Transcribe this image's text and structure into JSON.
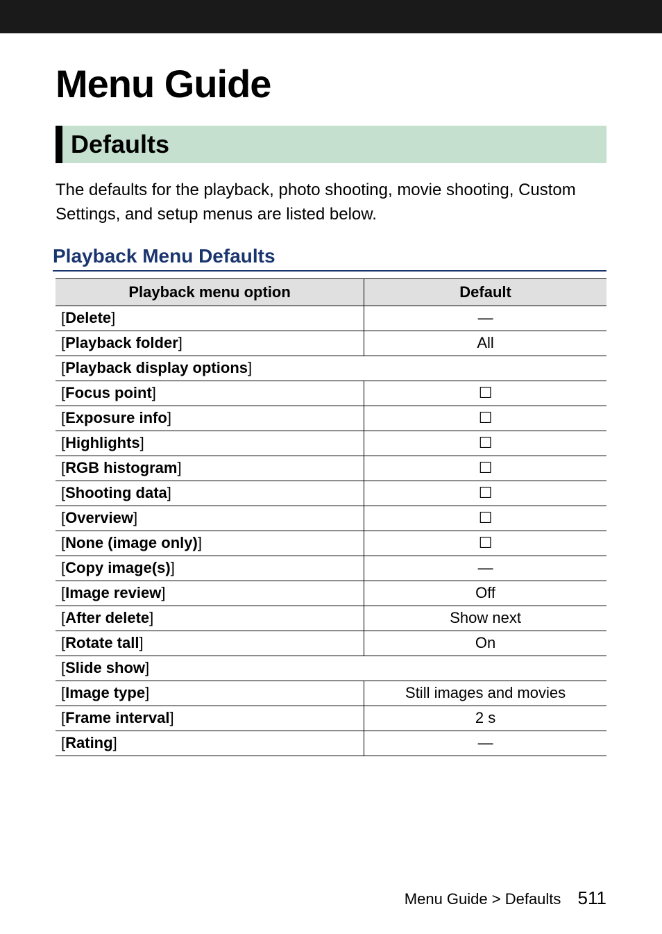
{
  "page": {
    "title": "Menu Guide",
    "section": "Defaults",
    "intro": "The defaults for the playback, photo shooting, movie shooting, Custom Settings, and setup menus are listed below.",
    "subheader": "Playback Menu Defaults",
    "table": {
      "headers": {
        "option": "Playback menu option",
        "default": "Default"
      },
      "rows": [
        {
          "label": "Delete",
          "default": "—",
          "indent": false,
          "spanDefault": false
        },
        {
          "label": "Playback folder",
          "default": "All",
          "indent": false,
          "spanDefault": false
        },
        {
          "label": "Playback display options",
          "default": "",
          "indent": false,
          "spanDefault": true
        },
        {
          "label": "Focus point",
          "default": "☐",
          "indent": true,
          "spanDefault": false
        },
        {
          "label": "Exposure info",
          "default": "☐",
          "indent": true,
          "spanDefault": false
        },
        {
          "label": "Highlights",
          "default": "☐",
          "indent": true,
          "spanDefault": false
        },
        {
          "label": "RGB histogram",
          "default": "☐",
          "indent": true,
          "spanDefault": false
        },
        {
          "label": "Shooting data",
          "default": "☐",
          "indent": true,
          "spanDefault": false
        },
        {
          "label": "Overview",
          "default": "☐",
          "indent": true,
          "spanDefault": false
        },
        {
          "label": "None (image only)",
          "default": "☐",
          "indent": true,
          "spanDefault": false
        },
        {
          "label": "Copy image(s)",
          "default": "—",
          "indent": false,
          "spanDefault": false
        },
        {
          "label": "Image review",
          "default": "Off",
          "indent": false,
          "spanDefault": false
        },
        {
          "label": "After delete",
          "default": "Show next",
          "indent": false,
          "spanDefault": false
        },
        {
          "label": "Rotate tall",
          "default": "On",
          "indent": false,
          "spanDefault": false
        },
        {
          "label": "Slide show",
          "default": "",
          "indent": false,
          "spanDefault": true
        },
        {
          "label": "Image type",
          "default": "Still images and movies",
          "indent": true,
          "spanDefault": false
        },
        {
          "label": "Frame interval",
          "default": "2 s",
          "indent": true,
          "spanDefault": false
        },
        {
          "label": "Rating",
          "default": "—",
          "indent": false,
          "spanDefault": false
        }
      ]
    },
    "footer": {
      "breadcrumb": "Menu Guide > Defaults",
      "page_number": "511"
    },
    "brackets": {
      "open": "[",
      "close": "]"
    }
  }
}
